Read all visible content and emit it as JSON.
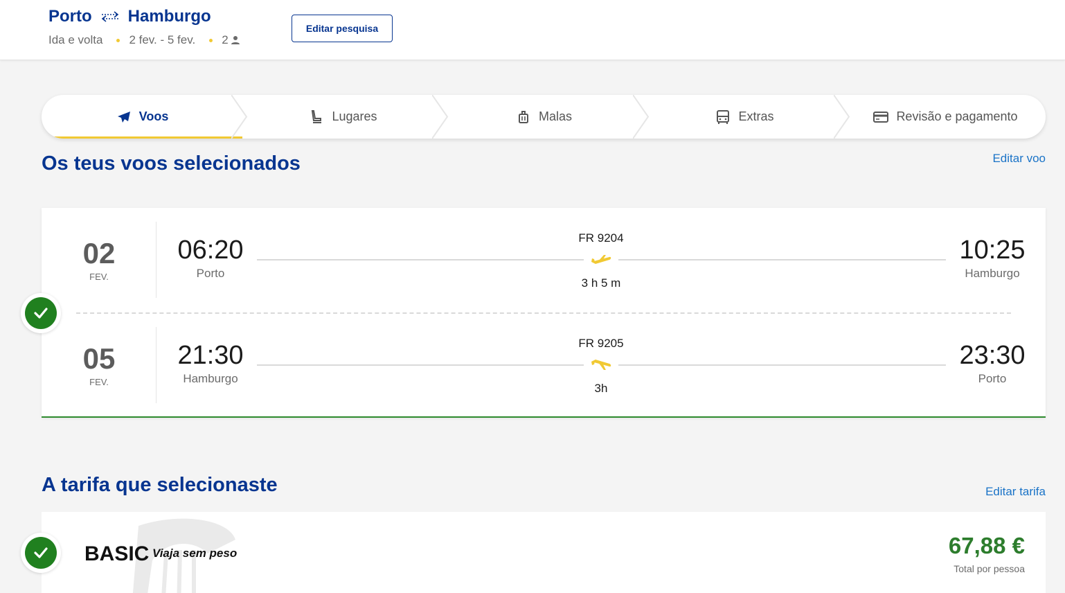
{
  "header": {
    "origin": "Porto",
    "destination": "Hamburgo",
    "trip_type": "Ida e volta",
    "dates": "2 fev. - 5 fev.",
    "passengers": "2",
    "edit_search_label": "Editar pesquisa"
  },
  "stepper": {
    "steps": [
      {
        "label": "Voos",
        "icon": "plane-icon",
        "active": true
      },
      {
        "label": "Lugares",
        "icon": "seat-icon"
      },
      {
        "label": "Malas",
        "icon": "luggage-icon"
      },
      {
        "label": "Extras",
        "icon": "bus-icon"
      },
      {
        "label": "Revisão e pagamento",
        "icon": "card-icon"
      }
    ]
  },
  "flights_section": {
    "title": "Os teus voos selecionados",
    "edit_label": "Editar voo",
    "flights": [
      {
        "day": "02",
        "month": "FEV.",
        "depart_time": "06:20",
        "depart_city": "Porto",
        "flight_no": "FR 9204",
        "duration": "3 h 5 m",
        "arrive_time": "10:25",
        "arrive_city": "Hamburgo"
      },
      {
        "day": "05",
        "month": "FEV.",
        "depart_time": "21:30",
        "depart_city": "Hamburgo",
        "flight_no": "FR 9205",
        "duration": "3h",
        "arrive_time": "23:30",
        "arrive_city": "Porto"
      }
    ]
  },
  "fare_section": {
    "title": "A tarifa que selecionaste",
    "edit_label": "Editar tarifa",
    "fare_name": "BASIC",
    "fare_tagline": "Viaja sem peso",
    "price": "67,88 €",
    "price_note": "Total por pessoa"
  },
  "colors": {
    "brand_blue": "#073590",
    "accent_yellow": "#f1c933",
    "success_green": "#20801f",
    "link_blue": "#1a73c7"
  }
}
